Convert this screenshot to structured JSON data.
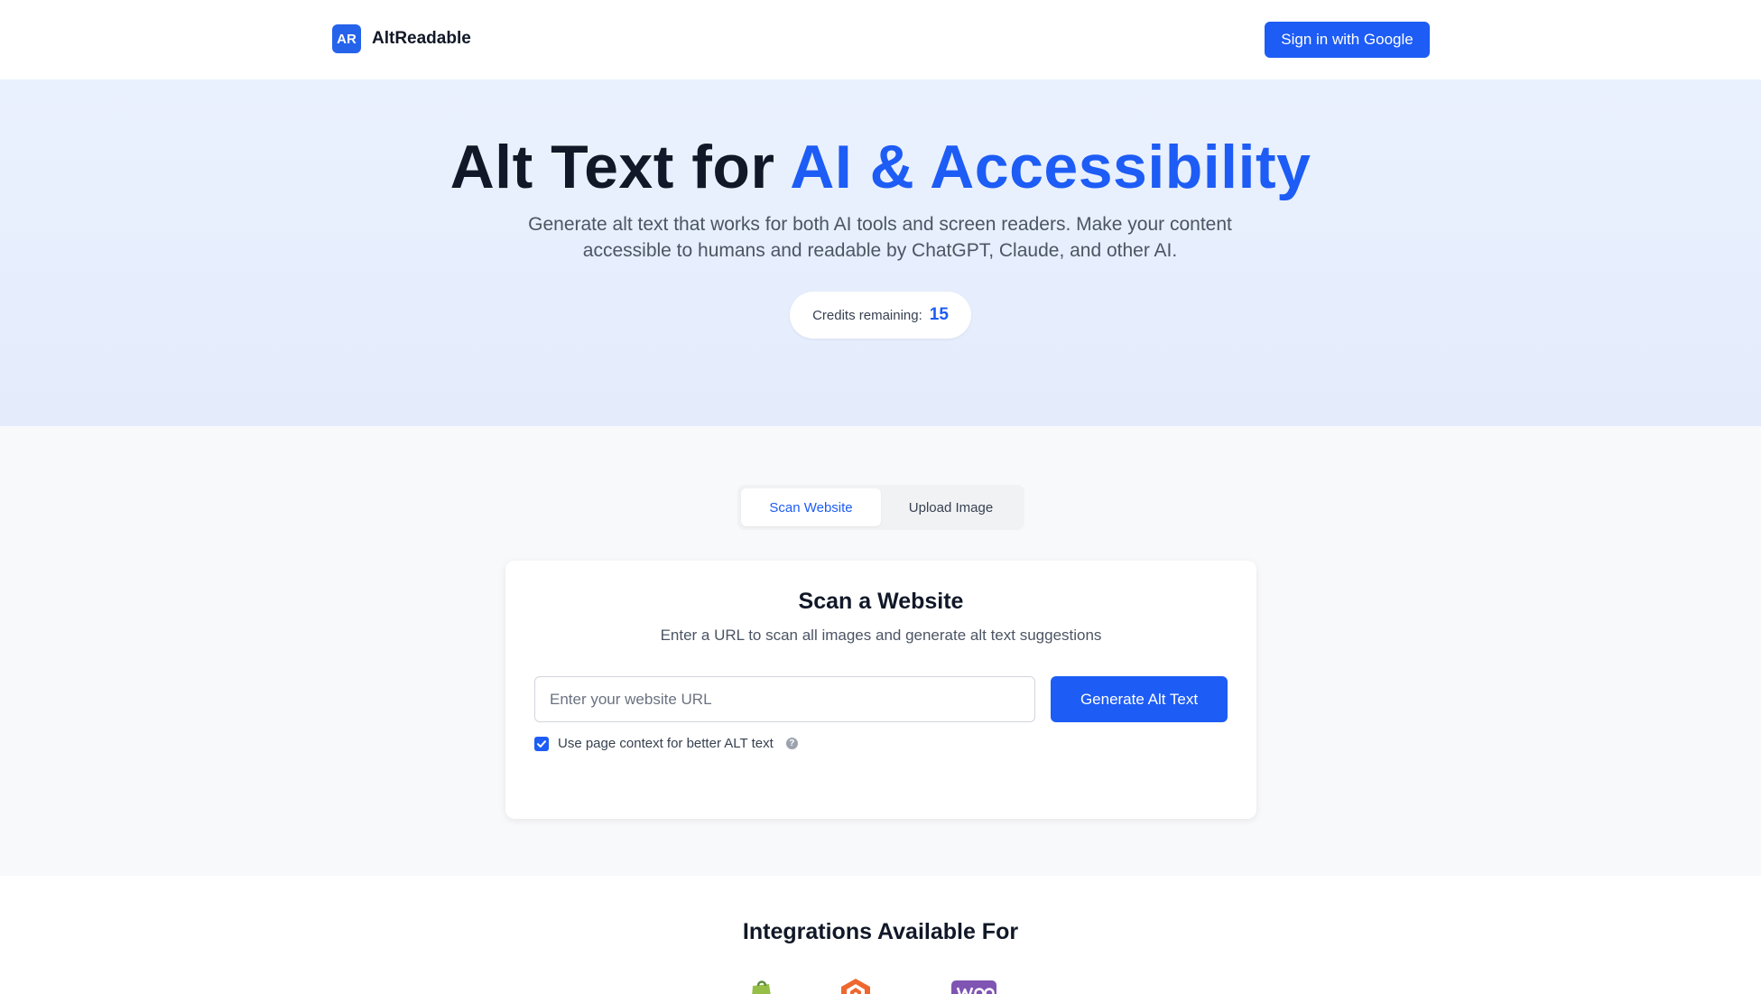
{
  "header": {
    "logo_mark": "AR",
    "logo_text": "AltReadable",
    "signin_label": "Sign in with Google"
  },
  "hero": {
    "title_plain": "Alt Text for ",
    "title_accent": "AI & Accessibility",
    "subtitle": "Generate alt text that works for both AI tools and screen readers. Make your content accessible to humans and readable by ChatGPT, Claude, and other AI.",
    "credits_label": "Credits remaining:",
    "credits_value": "15"
  },
  "tabs": [
    {
      "label": "Scan Website",
      "active": true
    },
    {
      "label": "Upload Image",
      "active": false
    }
  ],
  "scan_card": {
    "title": "Scan a Website",
    "subtitle": "Enter a URL to scan all images and generate alt text suggestions",
    "url_value": "",
    "url_placeholder": "Enter your website URL",
    "generate_label": "Generate Alt Text",
    "context_label": "Use page context for better ALT text",
    "context_checked": true
  },
  "integrations": {
    "title": "Integrations Available For",
    "logos": [
      "shopify-icon",
      "magento-icon",
      "woocommerce-icon"
    ]
  },
  "colors": {
    "primary": "#1d5cf5",
    "text_dark": "#111827",
    "text_muted": "#4b5563",
    "hero_bg": "#e8effd",
    "section_bg": "#f8f9fb"
  }
}
